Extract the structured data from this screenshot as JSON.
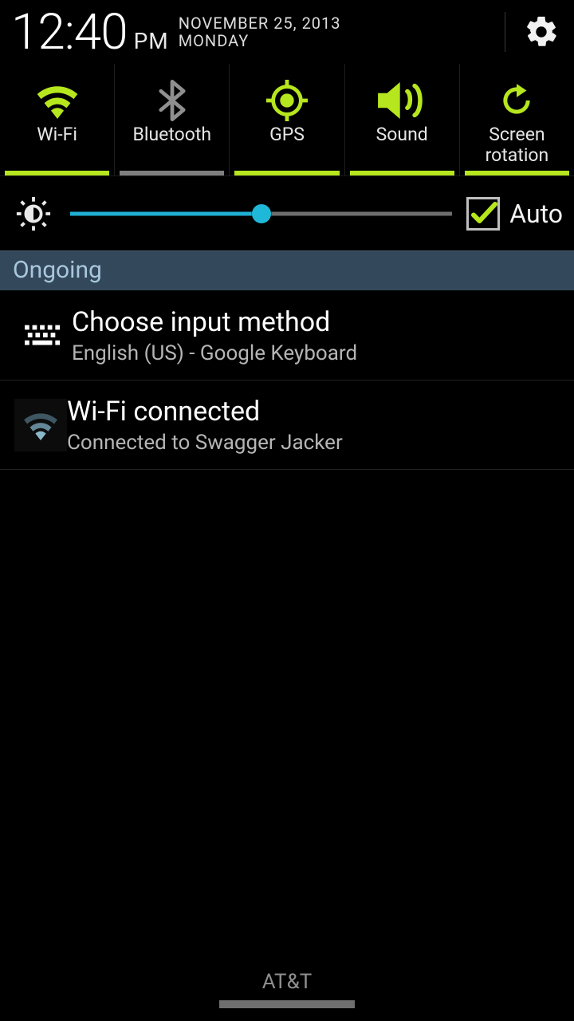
{
  "status": {
    "time": "12:40",
    "ampm": "PM",
    "date": "NOVEMBER 25, 2013",
    "day": "MONDAY"
  },
  "toggles": [
    {
      "label": "Wi-Fi",
      "icon": "wifi",
      "active": true
    },
    {
      "label": "Bluetooth",
      "icon": "bluetooth",
      "active": false
    },
    {
      "label": "GPS",
      "icon": "gps",
      "active": true
    },
    {
      "label": "Sound",
      "icon": "sound",
      "active": true
    },
    {
      "label": "Screen rotation",
      "icon": "rotate",
      "active": true
    }
  ],
  "brightness": {
    "value_percent": 50,
    "auto_label": "Auto",
    "auto_checked": true
  },
  "colors": {
    "accent": "#b6e61e",
    "slider": "#1fb0d4"
  },
  "section_header": "Ongoing",
  "notifications": [
    {
      "icon": "keyboard",
      "title": "Choose input method",
      "subtitle": "English (US) - Google Keyboard"
    },
    {
      "icon": "wifi-small",
      "title": "Wi-Fi connected",
      "subtitle": "Connected to Swagger Jacker"
    }
  ],
  "carrier": "AT&T"
}
